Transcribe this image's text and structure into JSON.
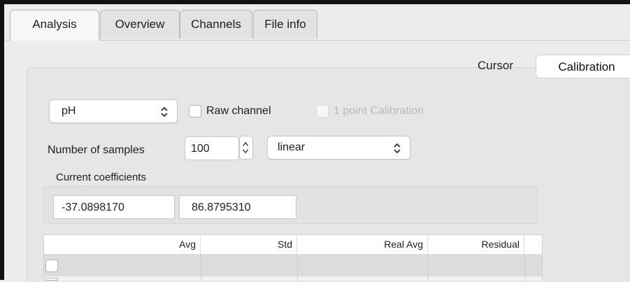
{
  "tabs": [
    {
      "label": "Analysis",
      "active": true
    },
    {
      "label": "Overview",
      "active": false
    },
    {
      "label": "Channels",
      "active": false
    },
    {
      "label": "File info",
      "active": false
    }
  ],
  "subtabs": {
    "cursor": "Cursor",
    "calibration": "Calibration",
    "selected": "Calibration"
  },
  "channel_select": {
    "value": "pH"
  },
  "raw_channel": {
    "label": "Raw channel",
    "checked": false
  },
  "one_point_calibration": {
    "label": "1 point Calibration",
    "checked": false,
    "enabled": false
  },
  "samples": {
    "label": "Number of samples",
    "value": "100"
  },
  "fit_select": {
    "value": "linear"
  },
  "coefficients": {
    "label": "Current coefficients",
    "values": [
      "-37.0898170",
      "86.8795310"
    ]
  },
  "table": {
    "headers": [
      "",
      "Avg",
      "Std",
      "Real Avg",
      "Residual"
    ],
    "rows": [
      {
        "checked": false
      }
    ]
  },
  "colors": {
    "accent": "#ffffff",
    "selected_row": "#dcdcdc"
  }
}
